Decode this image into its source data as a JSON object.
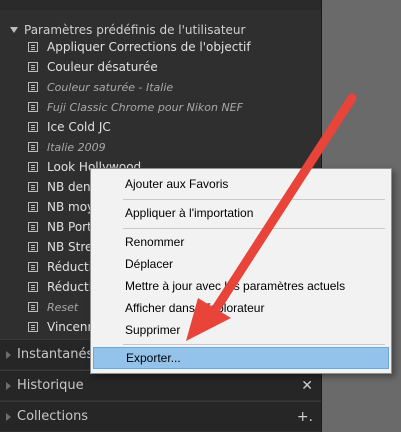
{
  "panel": {
    "group_title": "Paramètres prédéfinis de l'utilisateur",
    "presets": [
      {
        "label": "Appliquer Corrections de l'objectif",
        "italic": false
      },
      {
        "label": "Couleur désaturée",
        "italic": false
      },
      {
        "label": "Couleur saturée - Italie",
        "italic": true
      },
      {
        "label": "Fuji Classic Chrome pour Nikon NEF",
        "italic": true
      },
      {
        "label": "Ice Cold JC",
        "italic": false
      },
      {
        "label": "Italie 2009",
        "italic": true
      },
      {
        "label": "Look Hollywood",
        "italic": false
      },
      {
        "label": "NB dens",
        "italic": false
      },
      {
        "label": "NB moy",
        "italic": false
      },
      {
        "label": "NB Portr",
        "italic": false
      },
      {
        "label": "NB Stree",
        "italic": false
      },
      {
        "label": "Réduction",
        "italic": false
      },
      {
        "label": "Réduction",
        "italic": false
      },
      {
        "label": "Reset",
        "italic": true
      },
      {
        "label": "Vincenn",
        "italic": false
      }
    ],
    "sections": [
      {
        "label": "Instantanés",
        "right_icon": ""
      },
      {
        "label": "Historique",
        "right_icon": "✕"
      },
      {
        "label": "Collections",
        "right_icon": "+."
      }
    ]
  },
  "context_menu": {
    "items": [
      {
        "label": "Ajouter aux Favoris"
      },
      {
        "label": "Appliquer à l'importation"
      },
      {
        "label": "Renommer"
      },
      {
        "label": "Déplacer"
      },
      {
        "label": "Mettre à jour avec les paramètres actuels"
      },
      {
        "label": "Afficher dans l'Explorateur"
      },
      {
        "label": "Supprimer"
      },
      {
        "label": "Exporter..."
      }
    ],
    "highlighted_index": 7
  },
  "colors": {
    "panel_bg": "#2f2f2f",
    "menu_bg": "#f2f2f2",
    "highlight": "#93c2eb",
    "arrow": "#e8443a"
  }
}
